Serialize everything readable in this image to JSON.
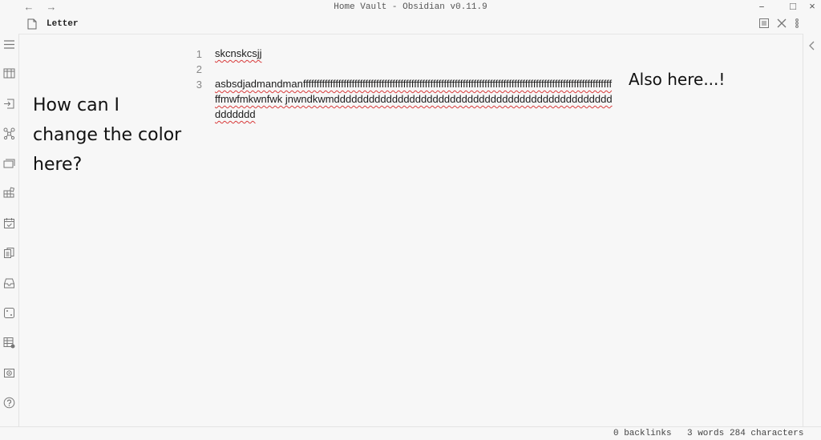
{
  "window": {
    "title": "Home Vault - Obsidian v0.11.9",
    "back_glyph": "←",
    "forward_glyph": "→",
    "minimize_glyph": "–",
    "maximize_glyph": "□",
    "close_glyph": "×"
  },
  "tab": {
    "title": "Letter",
    "icons": [
      "document-icon",
      "reading-view-icon",
      "close-icon",
      "more-options-icon"
    ]
  },
  "ribbon": {
    "icons": [
      "collapse-sidebar-icon",
      "kanban-icon",
      "open-file-icon",
      "graph-icon",
      "cards-icon",
      "plugins-icon",
      "calendar-icon",
      "copy-icon",
      "inbox-icon",
      "dice-icon",
      "table-icon",
      "vault-icon",
      "help-icon"
    ]
  },
  "right_sidebar": {
    "icons": [
      "expand-right-sidebar-icon"
    ]
  },
  "editor": {
    "line_numbers": [
      "1",
      "2",
      "3"
    ],
    "lines": [
      "skcnskcsjj",
      "",
      "asbsdjadmandmanffffffffffffffffffffffffffffffffffffffffffffffffffffffffffffffffffffffffffffffffffffffffffffffffffffffffffffffffffffmwfmkwnfwk jnwndkwmddddddddddddddddddddddddddddddddddddddddddddddddddddddd"
    ]
  },
  "annotations": {
    "left_lines": [
      "How can I",
      "change the color",
      "here?"
    ],
    "right": "Also here...!"
  },
  "status": {
    "backlinks": "0 backlinks",
    "words": "3 words",
    "characters": "284 characters"
  },
  "colors": {
    "background": "#f7f7f7",
    "spellcheck_underline": "#d83a3a",
    "accent": "#7b6cd9"
  }
}
